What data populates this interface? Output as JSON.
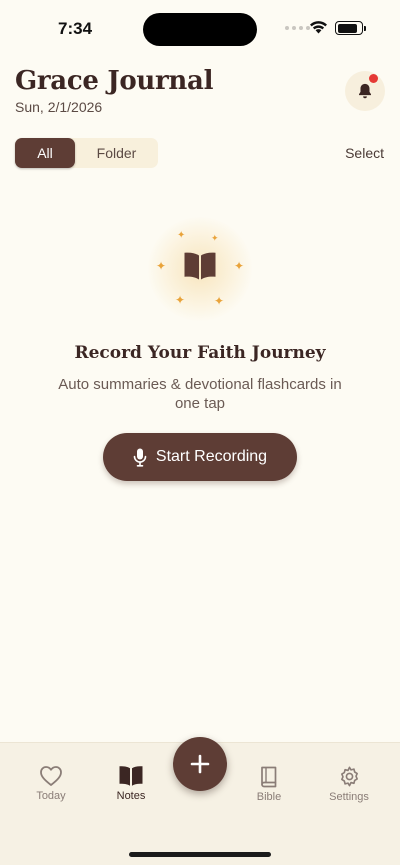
{
  "status_bar": {
    "time": "7:34"
  },
  "header": {
    "title": "Grace Journal",
    "date": "Sun, 2/1/2026"
  },
  "filters": {
    "all_label": "All",
    "folder_label": "Folder",
    "select_label": "Select"
  },
  "empty_state": {
    "title": "Record Your Faith Journey",
    "subtitle": "Auto summaries & devotional flashcards in one tap",
    "record_button_label": "Start Recording"
  },
  "tab_bar": {
    "today_label": "Today",
    "notes_label": "Notes",
    "bible_label": "Bible",
    "settings_label": "Settings",
    "active_tab": "Notes"
  },
  "colors": {
    "background": "#fdfbf3",
    "accent": "#5e3d35",
    "sparkle": "#e9a33a",
    "notification_dot": "#e53935"
  },
  "icons": {
    "notification": "bell-icon",
    "hero": "open-book-icon",
    "record": "microphone-icon",
    "fab": "plus-icon",
    "today": "heart-icon",
    "notes": "open-book-icon",
    "bible": "closed-book-icon",
    "settings": "gear-icon"
  }
}
